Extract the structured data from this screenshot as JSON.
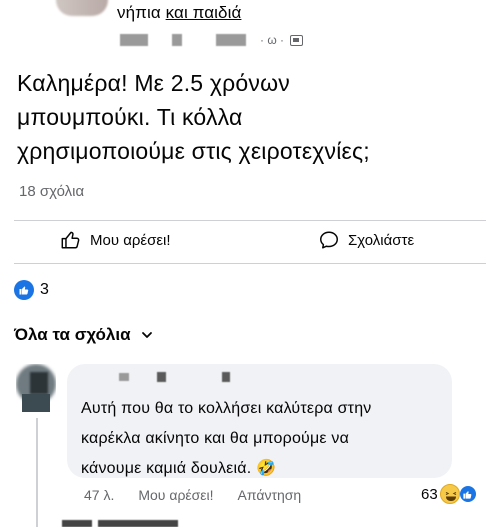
{
  "group": {
    "name_plain": "νήπια ",
    "name_link": "και παιδιά",
    "time": "ω",
    "icon": "globe-icon"
  },
  "post": {
    "text": "Καλημέρα! Με 2.5 χρόνων\nμπουμπούκι. Τι κόλλα\nχρησιμοποιούμε στις χειροτεχνίες;",
    "comment_count": "18 σχόλια"
  },
  "actions": {
    "like": "Μου αρέσει!",
    "comment": "Σχολιάστε"
  },
  "reactions": {
    "count": "3"
  },
  "comments_filter": {
    "label": "Όλα τα σχόλια"
  },
  "comment": {
    "text": "Αυτή που θα το κολλήσει καλύτερα στην\nκαρέκλα ακίνητο και θα μπορούμε να\nκάνουμε καμιά δουλειά. 🤣",
    "time": "47 λ.",
    "like": "Μου αρέσει!",
    "reply": "Απάντηση",
    "reaction_count": "63"
  },
  "colors": {
    "accent": "#1b74e4",
    "secondary_text": "#65676b",
    "bubble": "#f0f2f5"
  }
}
